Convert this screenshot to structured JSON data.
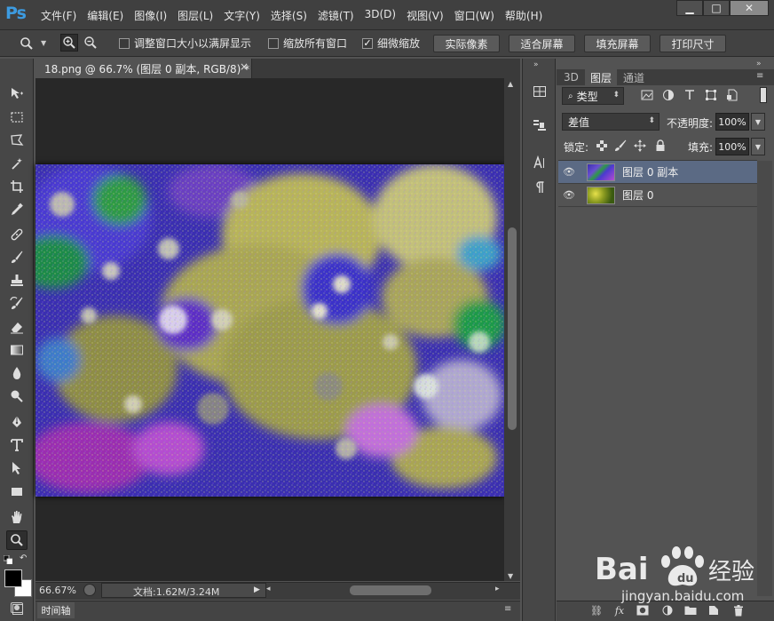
{
  "app": {
    "logo": "Ps",
    "window_buttons": [
      "▁",
      "□",
      "✕"
    ]
  },
  "menus": [
    "文件(F)",
    "编辑(E)",
    "图像(I)",
    "图层(L)",
    "文字(Y)",
    "选择(S)",
    "滤镜(T)",
    "3D(D)",
    "视图(V)",
    "窗口(W)",
    "帮助(H)"
  ],
  "options": {
    "resize_windows_label": "调整窗口大小以满屏显示",
    "resize_windows_checked": false,
    "zoom_all_label": "缩放所有窗口",
    "zoom_all_checked": false,
    "scrubby_label": "细微缩放",
    "scrubby_checked": true,
    "scrubby_mark": "✓",
    "actual_pixels": "实际像素",
    "fit_screen": "适合屏幕",
    "fill_screen": "填充屏幕",
    "print_size": "打印尺寸"
  },
  "document": {
    "tab_title": "18.png @ 66.7% (图层 0 副本, RGB/8) *",
    "close": "×",
    "zoom": "66.67%",
    "doc_info": "文档:1.62M/3.24M"
  },
  "timeline": {
    "label": "时间轴"
  },
  "panel": {
    "tabs": [
      "3D",
      "图层",
      "通道"
    ],
    "active_tab": "图层",
    "filter_kind": "类型",
    "blend_mode": "差值",
    "opacity_label": "不透明度:",
    "opacity_value": "100%",
    "lock_label": "锁定:",
    "fill_label": "填充:",
    "fill_value": "100%",
    "layers": [
      {
        "name": "图层 0 副本",
        "selected": true
      },
      {
        "name": "图层 0",
        "selected": false
      }
    ]
  },
  "colors": {
    "accent_logo": "#3d9be0",
    "selected_layer": "#5b6a84"
  },
  "watermark": {
    "brand": "Bai",
    "brand2": "经验",
    "url": "jingyan.baidu.com"
  }
}
